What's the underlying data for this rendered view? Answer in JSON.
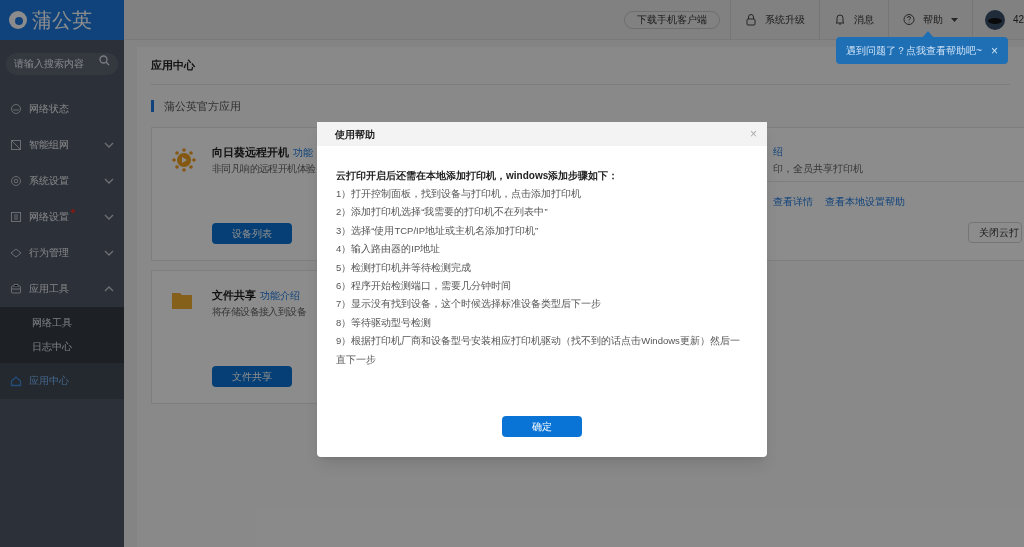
{
  "logo": {
    "text": "蒲公英"
  },
  "search": {
    "placeholder": "请输入搜索内容"
  },
  "sidebar": {
    "items": [
      {
        "label": "网络状态",
        "has_children": false,
        "expanded": false,
        "notification": false,
        "selected": false
      },
      {
        "label": "智能组网",
        "has_children": true,
        "expanded": false,
        "notification": false,
        "selected": false
      },
      {
        "label": "系统设置",
        "has_children": true,
        "expanded": false,
        "notification": false,
        "selected": false
      },
      {
        "label": "网络设置",
        "has_children": true,
        "expanded": false,
        "notification": true,
        "selected": false
      },
      {
        "label": "行为管理",
        "has_children": true,
        "expanded": false,
        "notification": false,
        "selected": false
      },
      {
        "label": "应用工具",
        "has_children": true,
        "expanded": true,
        "notification": false,
        "selected": false,
        "children": [
          {
            "label": "网络工具",
            "selected": false
          },
          {
            "label": "日志中心",
            "selected": false
          }
        ]
      },
      {
        "label": "应用中心",
        "has_children": false,
        "expanded": false,
        "notification": false,
        "selected": true
      }
    ]
  },
  "top_bar": {
    "download_button": "下载手机客户端",
    "items": [
      {
        "label": "系统升级",
        "dropdown": false
      },
      {
        "label": "消息",
        "dropdown": false
      },
      {
        "label": "帮助",
        "dropdown": true
      }
    ],
    "user": "42"
  },
  "tooltip": {
    "text": "遇到问题了？点我查看帮助吧~",
    "close": "×"
  },
  "page": {
    "title": "应用中心",
    "section": "蒲公英官方应用",
    "cards": [
      {
        "title": "向日葵远程开机",
        "link": "功能",
        "description": "非同凡响的远程开机体验",
        "button": "设备列表"
      },
      {
        "title": "文件共享",
        "link": "功能介绍",
        "description": "将存储设备接入到设备",
        "button": "文件共享"
      }
    ],
    "right_card": {
      "link": "绍",
      "description": "印，全员共享打印机",
      "links": [
        "查看详情",
        "查看本地设置帮助"
      ],
      "button": "关闭云打"
    }
  },
  "modal": {
    "title": "使用帮助",
    "close": "×",
    "heading": "云打印开启后还需在本地添加打印机，windows添加步骤如下：",
    "steps": [
      "1）打开控制面板，找到设备与打印机，点击添加打印机",
      "2）添加打印机选择“我需要的打印机不在列表中”",
      "3）选择“使用TCP/IP地址或主机名添加打印机”",
      "4）输入路由器的IP地址",
      "5）检测打印机并等待检测完成",
      "6）程序开始检测端口，需要几分钟时间",
      "7）显示没有找到设备，这个时候选择标准设备类型后下一步",
      "8）等待驱动型号检测",
      "9）根据打印机厂商和设备型号安装相应打印机驱动（找不到的话点击Windows更新）然后一直下一步"
    ],
    "ok_button": "确定"
  }
}
